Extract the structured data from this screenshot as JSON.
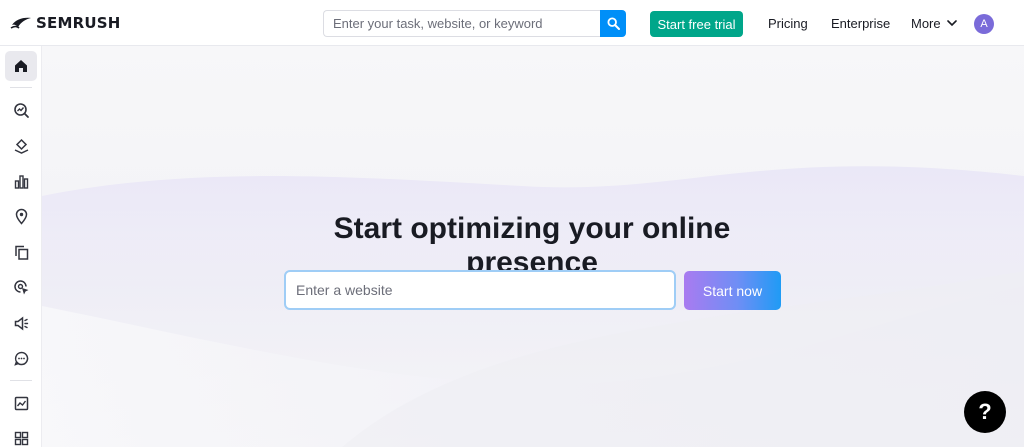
{
  "header": {
    "logo_text": "SEMRUSH",
    "search_placeholder": "Enter your task, website, or keyword",
    "trial_label": "Start free trial",
    "nav": {
      "pricing": "Pricing",
      "enterprise": "Enterprise",
      "more": "More"
    },
    "avatar_letter": "A"
  },
  "sidebar": {
    "items": [
      {
        "icon": "home-icon",
        "active": true
      },
      {
        "icon": "seo-icon"
      },
      {
        "icon": "traffic-icon"
      },
      {
        "icon": "bar-chart-icon"
      },
      {
        "icon": "location-pin-icon"
      },
      {
        "icon": "content-icon"
      },
      {
        "icon": "ai-cursor-icon"
      },
      {
        "icon": "megaphone-icon"
      },
      {
        "icon": "chat-icon"
      },
      {
        "icon": "report-icon"
      },
      {
        "icon": "apps-grid-icon"
      }
    ]
  },
  "hero": {
    "title": "Start optimizing your online presence",
    "input_placeholder": "Enter a website",
    "button_label": "Start now"
  },
  "help": {
    "label": "?"
  },
  "colors": {
    "brand_orange": "#ff642d",
    "search_blue": "#008ff8",
    "trial_green": "#00a68a",
    "avatar_purple": "#7a6bd9"
  }
}
